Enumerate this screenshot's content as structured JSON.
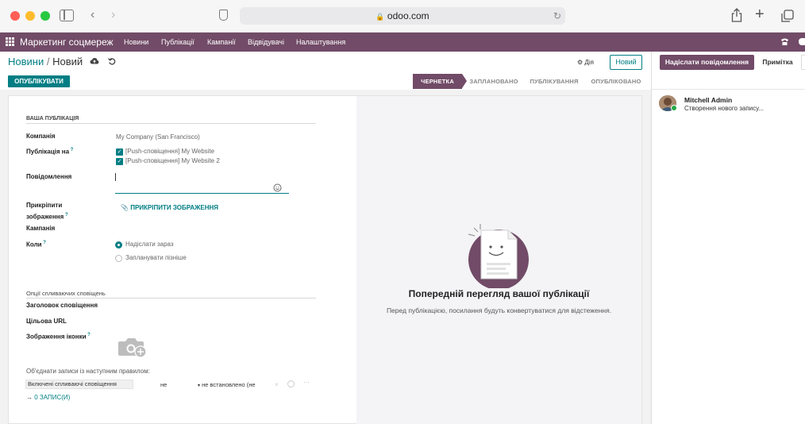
{
  "browser": {
    "url": "odoo.com"
  },
  "navbar": {
    "app_name": "Маркетинг соцмереж",
    "menu": [
      "Новини",
      "Публікації",
      "Кампанії",
      "Відвідувачі",
      "Налаштування"
    ]
  },
  "control": {
    "breadcrumb_parent": "Новини",
    "breadcrumb_sep": "/",
    "breadcrumb_current": "Новий",
    "action_label": "Дія",
    "new_label": "Новий"
  },
  "form": {
    "publish_button": "ОПУБЛІКУВАТИ",
    "stages": [
      "ЧЕРНЕТКА",
      "ЗАПЛАНОВАНО",
      "ПУБЛІКУВАННЯ",
      "ОПУБЛІКОВАНО"
    ],
    "active_stage": "ЧЕРНЕТКА",
    "section_publication": "ВАША ПУБЛІКАЦІЯ",
    "company_label": "Компанія",
    "company_value": "My Company (San Francisco)",
    "publish_on_label": "Публікація на",
    "accounts": [
      "[Push-сповіщення] My Website",
      "[Push-сповіщення] My Website 2"
    ],
    "message_label": "Повідомлення",
    "attach_label_1": "Прикріпити",
    "attach_label_2": "зображення",
    "attach_button": "ПРИКРІПИТИ ЗОБРАЖЕННЯ",
    "campaign_label": "Кампанія",
    "when_label": "Коли",
    "when_options": [
      "Надіслати зараз",
      "Запланувати пізніше"
    ],
    "when_selected": "Надіслати зараз",
    "section_push": "Опції спливаючих сповіщень",
    "push_title_label": "Заголовок сповіщення",
    "target_url_label": "Цільова URL",
    "icon_image_label": "Зображення іконки",
    "domain_label": "Об'єднати записи із наступним правилом:",
    "domain_field": "Включені спливаючі сповіщення",
    "domain_operator": "не",
    "domain_value": "не встановлено (не",
    "records_link": "0 ЗАПИС(И)"
  },
  "preview": {
    "title": "Попередній перегляд вашої публікації",
    "subtitle": "Перед публікацією, посилання будуть конвертуватися для відстеження."
  },
  "chatter": {
    "send_message": "Надіслати повідомлення",
    "log_note": "Примітка",
    "author": "Mitchell Admin",
    "message": "Створення нового запису..."
  },
  "colors": {
    "brand": "#714b67",
    "accent": "#017e84"
  }
}
